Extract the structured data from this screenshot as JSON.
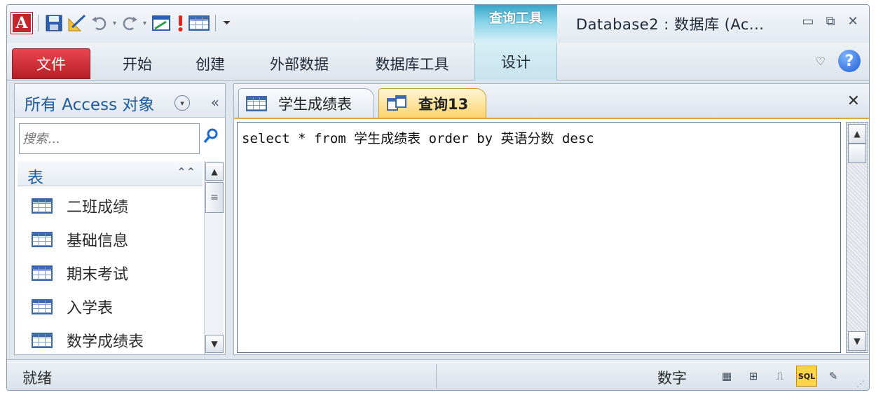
{
  "titlebar": {
    "app_logo": "A",
    "context_tab_header": "查询工具",
    "window_title": "Database2 : 数据库 (Ac...",
    "minimize": "▭",
    "restore": "⧉",
    "close": "✕"
  },
  "ribbon": {
    "tabs": [
      {
        "label": "文件"
      },
      {
        "label": "开始"
      },
      {
        "label": "创建"
      },
      {
        "label": "外部数据"
      },
      {
        "label": "数据库工具"
      },
      {
        "label": "设计"
      }
    ],
    "help": "?"
  },
  "nav": {
    "title": "所有 Access 对象",
    "search_placeholder": "搜索...",
    "group_label": "表",
    "items": [
      {
        "label": "二班成绩"
      },
      {
        "label": "基础信息"
      },
      {
        "label": "期末考试"
      },
      {
        "label": "入学表"
      },
      {
        "label": "数学成绩表"
      }
    ]
  },
  "documents": {
    "tabs": [
      {
        "label": "学生成绩表"
      },
      {
        "label": "查询13"
      }
    ],
    "sql_text": "select * from 学生成绩表 order by 英语分数 desc"
  },
  "status": {
    "left": "就绪",
    "mode": "数字",
    "sql_view": "SQL"
  },
  "colors": {
    "file_tab": "#c81f2a",
    "context_tab": "#35a5c8",
    "active_doc_tab": "#fcd46e",
    "nav_title": "#1d5a9c"
  }
}
